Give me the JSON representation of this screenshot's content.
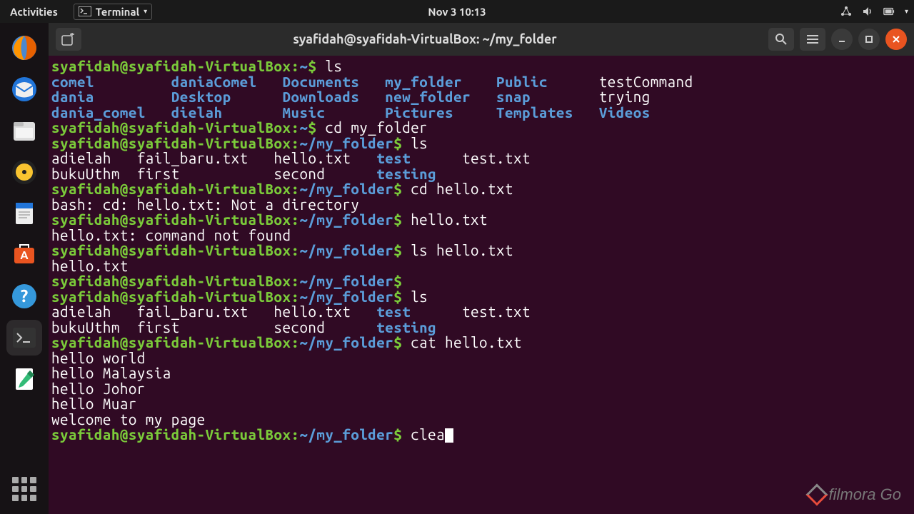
{
  "topbar": {
    "activities": "Activities",
    "app_name": "Terminal",
    "datetime": "Nov 3  10:13"
  },
  "window": {
    "title": "syafidah@syafidah-VirtualBox: ~/my_folder"
  },
  "prompt": {
    "user_host": "syafidah@syafidah-VirtualBox",
    "home": "~",
    "folder": "~/my_folder",
    "sigil": "$"
  },
  "commands": {
    "ls": "ls",
    "cd_my_folder": "cd my_folder",
    "cd_hello": "cd hello.txt",
    "hello_txt": "hello.txt",
    "ls_hello": "ls hello.txt",
    "cat_hello": "cat hello.txt",
    "clea": "clea"
  },
  "ls_home": {
    "r1": {
      "c1": "comel",
      "c2": "daniaComel",
      "c3": "Documents",
      "c4": "my_folder",
      "c5": "Public",
      "c6": "testCommand"
    },
    "r2": {
      "c1": "dania",
      "c2": "Desktop",
      "c3": "Downloads",
      "c4": "new_folder",
      "c5": "snap",
      "c6": "trying"
    },
    "r3": {
      "c1": "dania_comel",
      "c2": "dielah",
      "c3": "Music",
      "c4": "Pictures",
      "c5": "Templates",
      "c6": "Videos"
    }
  },
  "ls_folder": {
    "r1": {
      "c1": "adielah",
      "c2": "fail_baru.txt",
      "c3": "hello.txt",
      "c4": "test",
      "c5": "test.txt"
    },
    "r2": {
      "c1": "bukuUthm",
      "c2": "first",
      "c3": "second",
      "c4": "testing",
      "c5": ""
    }
  },
  "errors": {
    "not_dir": "bash: cd: hello.txt: Not a directory",
    "not_found": "hello.txt: command not found"
  },
  "ls_hello_out": "hello.txt",
  "cat_out": {
    "l1": "hello world",
    "l2": "hello Malaysia",
    "l3": "hello Johor",
    "l4": "hello Muar",
    "l5": "welcome to my page"
  },
  "watermark": "filmora Go"
}
